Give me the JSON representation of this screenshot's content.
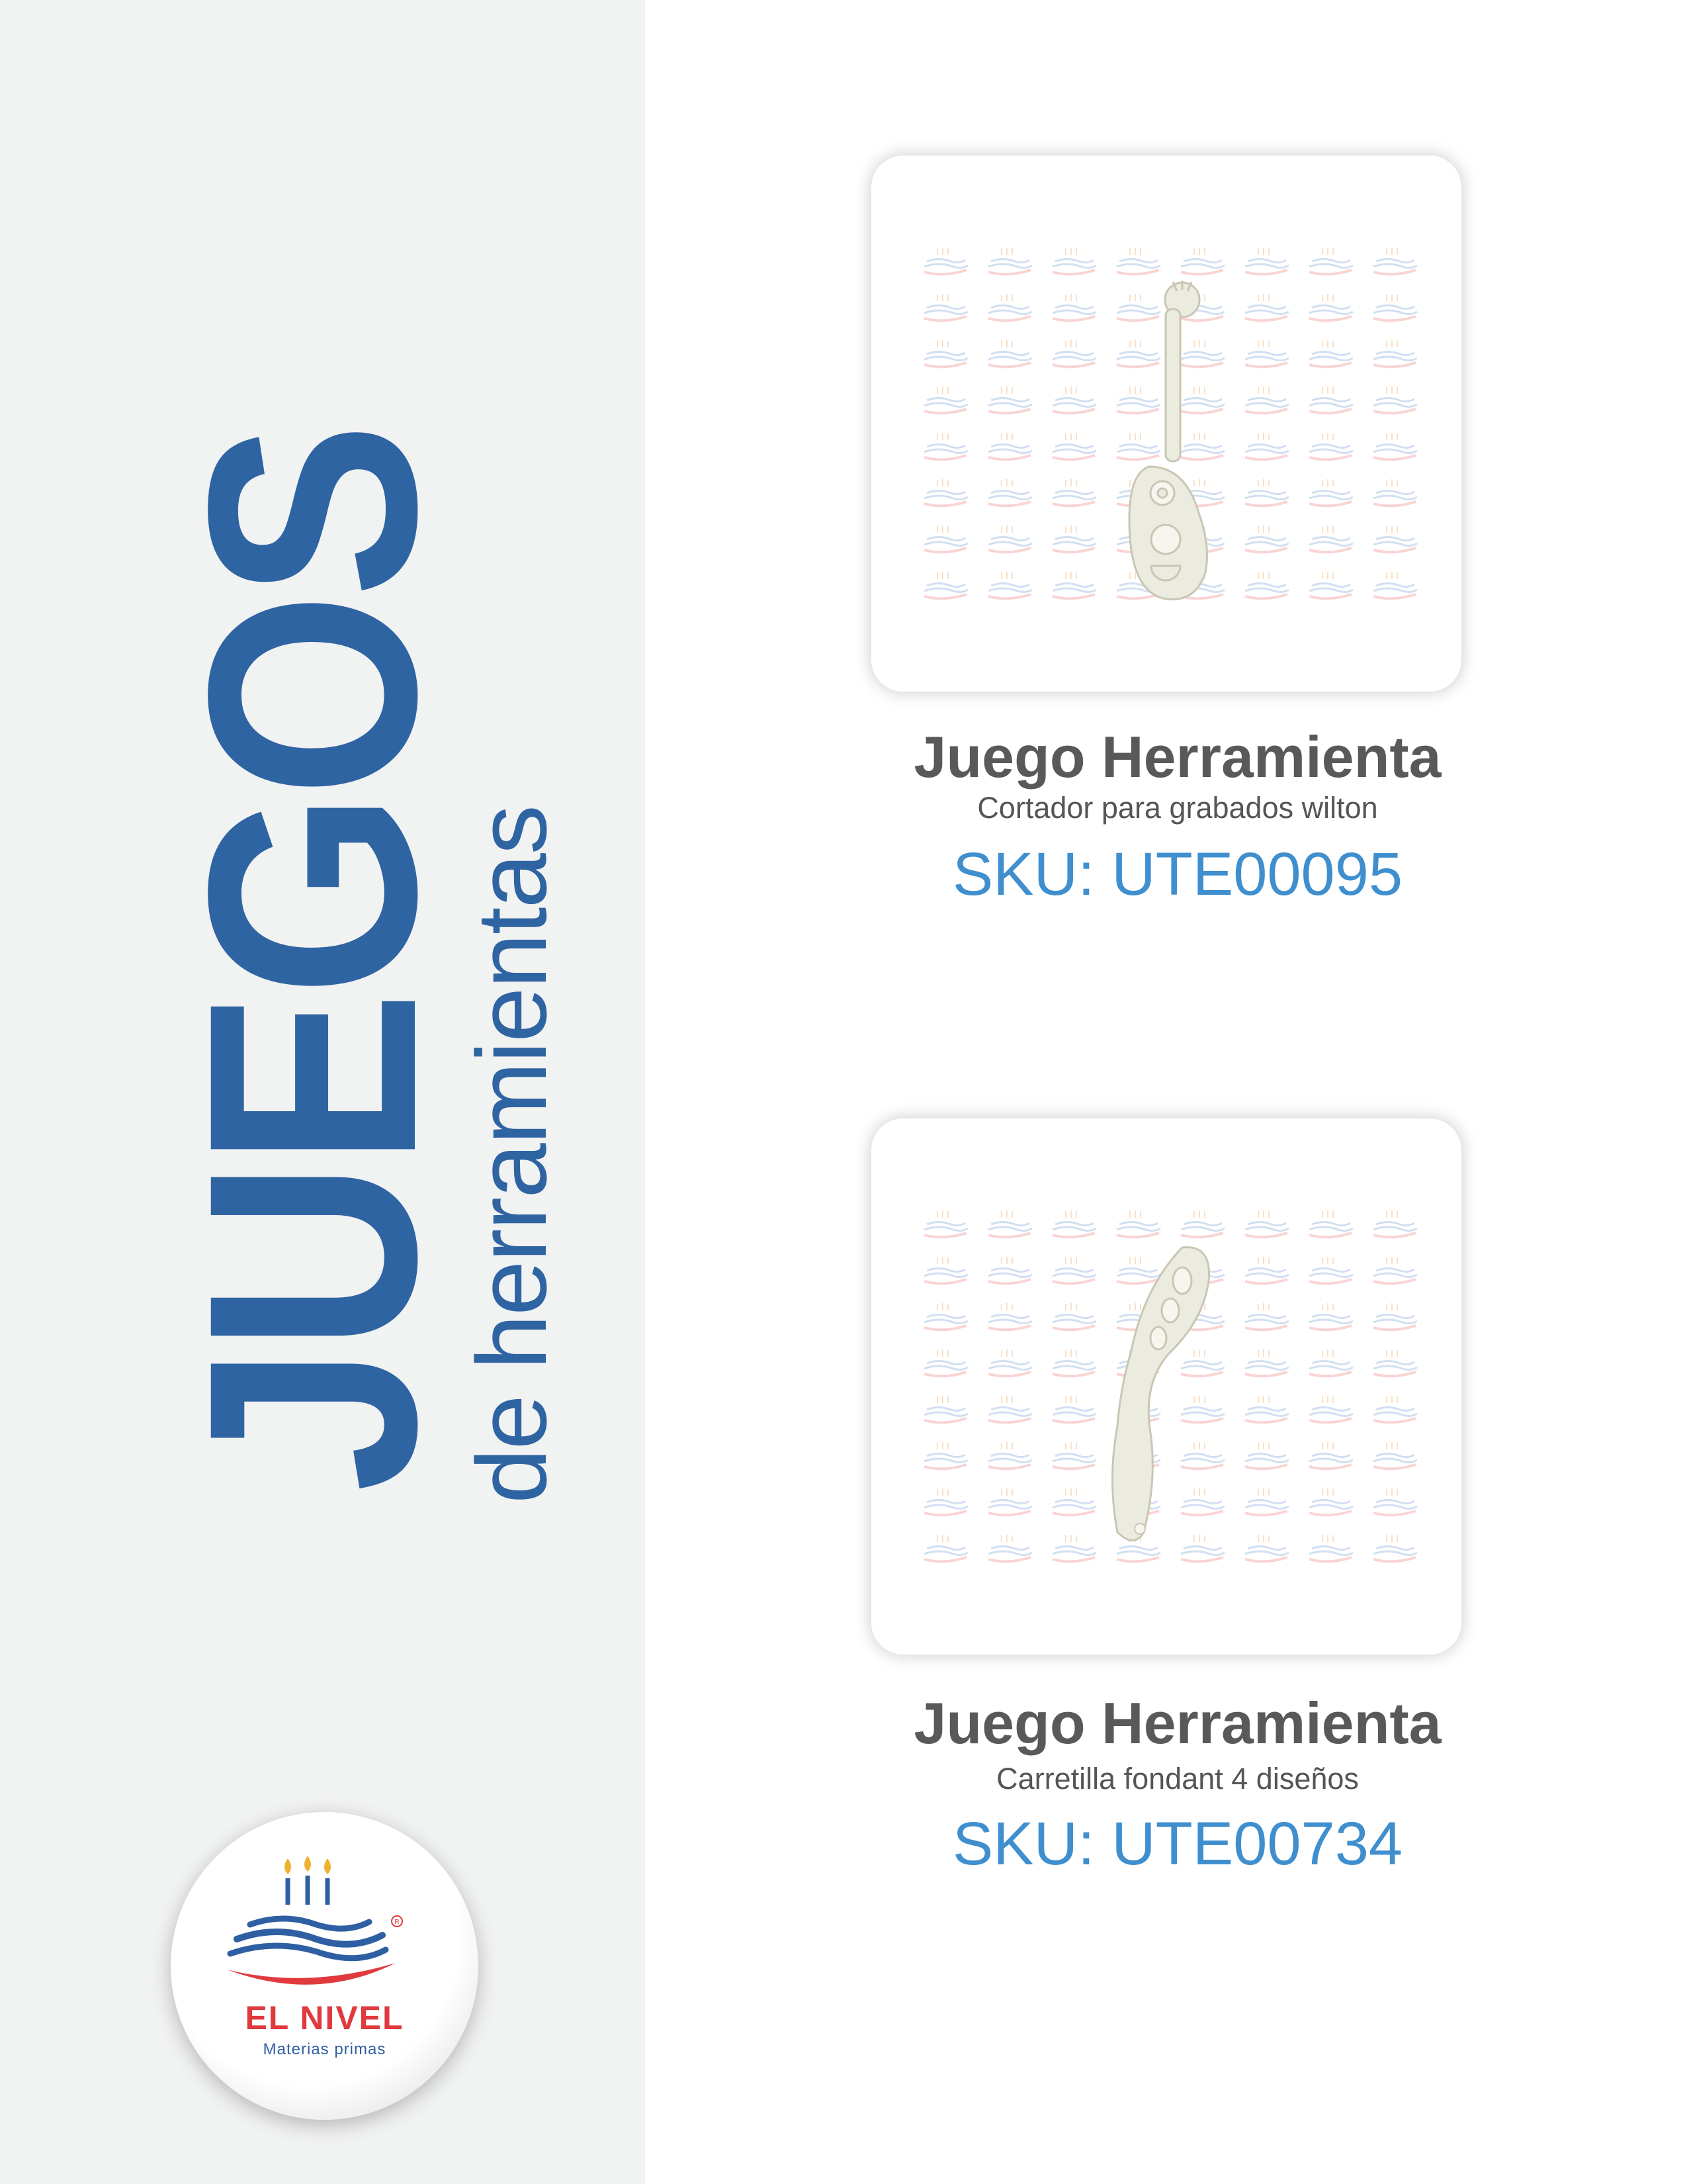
{
  "colors": {
    "brand_blue": "#2f64a3",
    "sku_blue": "#3f8fcf",
    "title_gray": "#58595b",
    "desc_gray": "#555555",
    "sidebar_bg": "#f1f2f2",
    "logo_red": "#e03a3e",
    "logo_blue": "#2f5fa3"
  },
  "sidebar": {
    "title_big": "JUEGOS",
    "title_small": "de herramientas"
  },
  "logo": {
    "name": "EL NIVEL",
    "tagline": "Materias primas",
    "icon": "birthday-cake-icon"
  },
  "products": [
    {
      "title": "Juego Herramienta",
      "description": "Cortador para grabados wilton",
      "sku": "SKU: UTE00095"
    },
    {
      "title": "Juego Herramienta",
      "description": "Carretilla fondant 4 diseños",
      "sku": "SKU: UTE00734"
    }
  ]
}
